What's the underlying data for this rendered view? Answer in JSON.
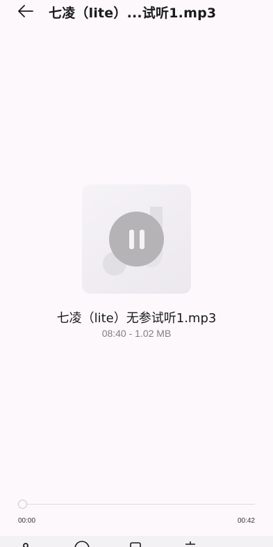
{
  "header": {
    "title": "七凌（lite）...试听1.mp3"
  },
  "file": {
    "name": "七凌（lite）无参试听1.mp3",
    "meta": "08:40 - 1.02 MB"
  },
  "player": {
    "elapsed": "00:00",
    "duration": "00:42",
    "progress_fraction": 0
  },
  "icons": {
    "back": "arrow-left-icon",
    "pause": "pause-icon",
    "art": "music-note-icon",
    "bottom_bar": [
      "share-icon",
      "favorite-icon",
      "copy-icon",
      "delete-icon",
      "more-icon"
    ]
  },
  "colors": {
    "background": "#fcf8fc",
    "pause_button": "#b5b3b6"
  }
}
